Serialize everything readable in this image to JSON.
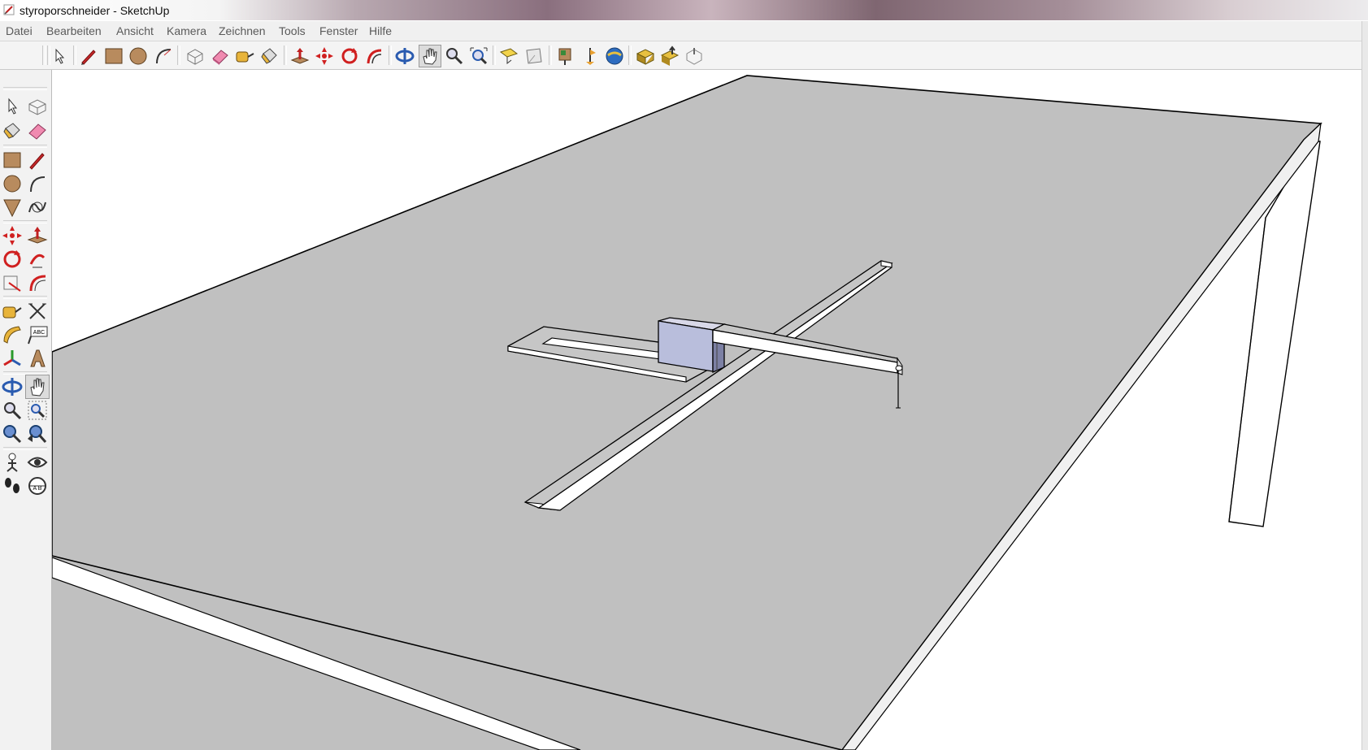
{
  "window": {
    "title": "styroporschneider - SketchUp"
  },
  "menu": {
    "items": [
      "Datei",
      "Bearbeiten",
      "Ansicht",
      "Kamera",
      "Zeichnen",
      "Tools",
      "Fenster",
      "Hilfe"
    ]
  },
  "toolbar": {
    "tools": [
      "select-icon",
      "pencil-icon",
      "rectangle-icon",
      "circle-icon",
      "arc-icon",
      "make-component-icon",
      "eraser-icon",
      "tape-measure-icon",
      "paint-bucket-icon",
      "push-pull-icon",
      "move-icon",
      "rotate-icon",
      "follow-me-icon",
      "orbit-icon",
      "pan-icon",
      "zoom-icon",
      "zoom-extents-icon",
      "previous-view-icon",
      "next-view-icon",
      "add-location-icon",
      "toggle-terrain-icon",
      "google-earth-icon",
      "get-models-icon",
      "share-model-icon",
      "share-component-icon"
    ],
    "active_tool": "pan-icon"
  },
  "left_toolbar": {
    "tools": [
      "select-icon",
      "make-component-icon",
      "paint-bucket-icon",
      "eraser-icon",
      "rectangle-icon",
      "line-icon",
      "circle-icon",
      "arc-icon",
      "polygon-icon",
      "freehand-icon",
      "move-icon",
      "push-pull-icon",
      "rotate-icon",
      "follow-me-icon",
      "scale-icon",
      "offset-icon",
      "tape-measure-icon",
      "dimension-icon",
      "protractor-icon",
      "text-icon",
      "axes-icon",
      "3d-text-icon",
      "orbit-icon",
      "pan-icon",
      "zoom-icon",
      "zoom-window-icon",
      "zoom-extents-icon",
      "previous-view-icon",
      "position-camera-icon",
      "look-around-icon",
      "walk-icon",
      "section-plane-icon"
    ],
    "active_tool": "pan-icon",
    "text_labels": {
      "text_tool": "ABC",
      "section_plane": "A B"
    }
  },
  "scene": {
    "description_colors": {
      "table_top": "#c0c0c0",
      "edge": "#000000",
      "carriage_face": "#b9bedc",
      "carriage_shadow": "#7c80a4",
      "rail_face": "#ffffff"
    }
  }
}
